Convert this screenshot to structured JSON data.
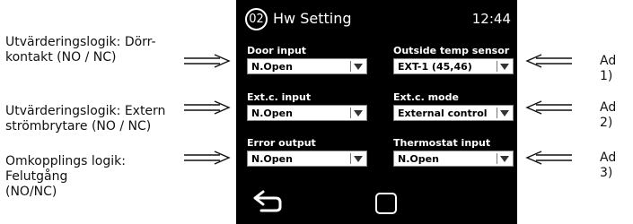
{
  "left_notes": [
    {
      "text": "Utvärderingslogik: Dörr-\nkontakt (NO / NC)"
    },
    {
      "text": "Utvärderingslogik: Extern\nströmbrytare (NO / NC)"
    },
    {
      "text": "Omkopplings logik:\nFelutgång\n(NO/NC)"
    }
  ],
  "right_notes": [
    "Ad 1)",
    "Ad 2)",
    "Ad 3)"
  ],
  "screen": {
    "page_number": "02",
    "title": "Hw Setting",
    "time": "12:44",
    "fields": [
      {
        "label": "Door input",
        "value": "N.Open"
      },
      {
        "label": "Outside temp sensor",
        "value": "EXT-1 (45,46)"
      },
      {
        "label": "Ext.c. input",
        "value": "N.Open"
      },
      {
        "label": "Ext.c. mode",
        "value": "External control"
      },
      {
        "label": "Error output",
        "value": "N.Open"
      },
      {
        "label": "Thermostat input",
        "value": "N.Open"
      }
    ]
  },
  "icons": {
    "back": "back-arrow-icon",
    "home": "home-square-icon",
    "dropdown": "chevron-down-icon"
  }
}
